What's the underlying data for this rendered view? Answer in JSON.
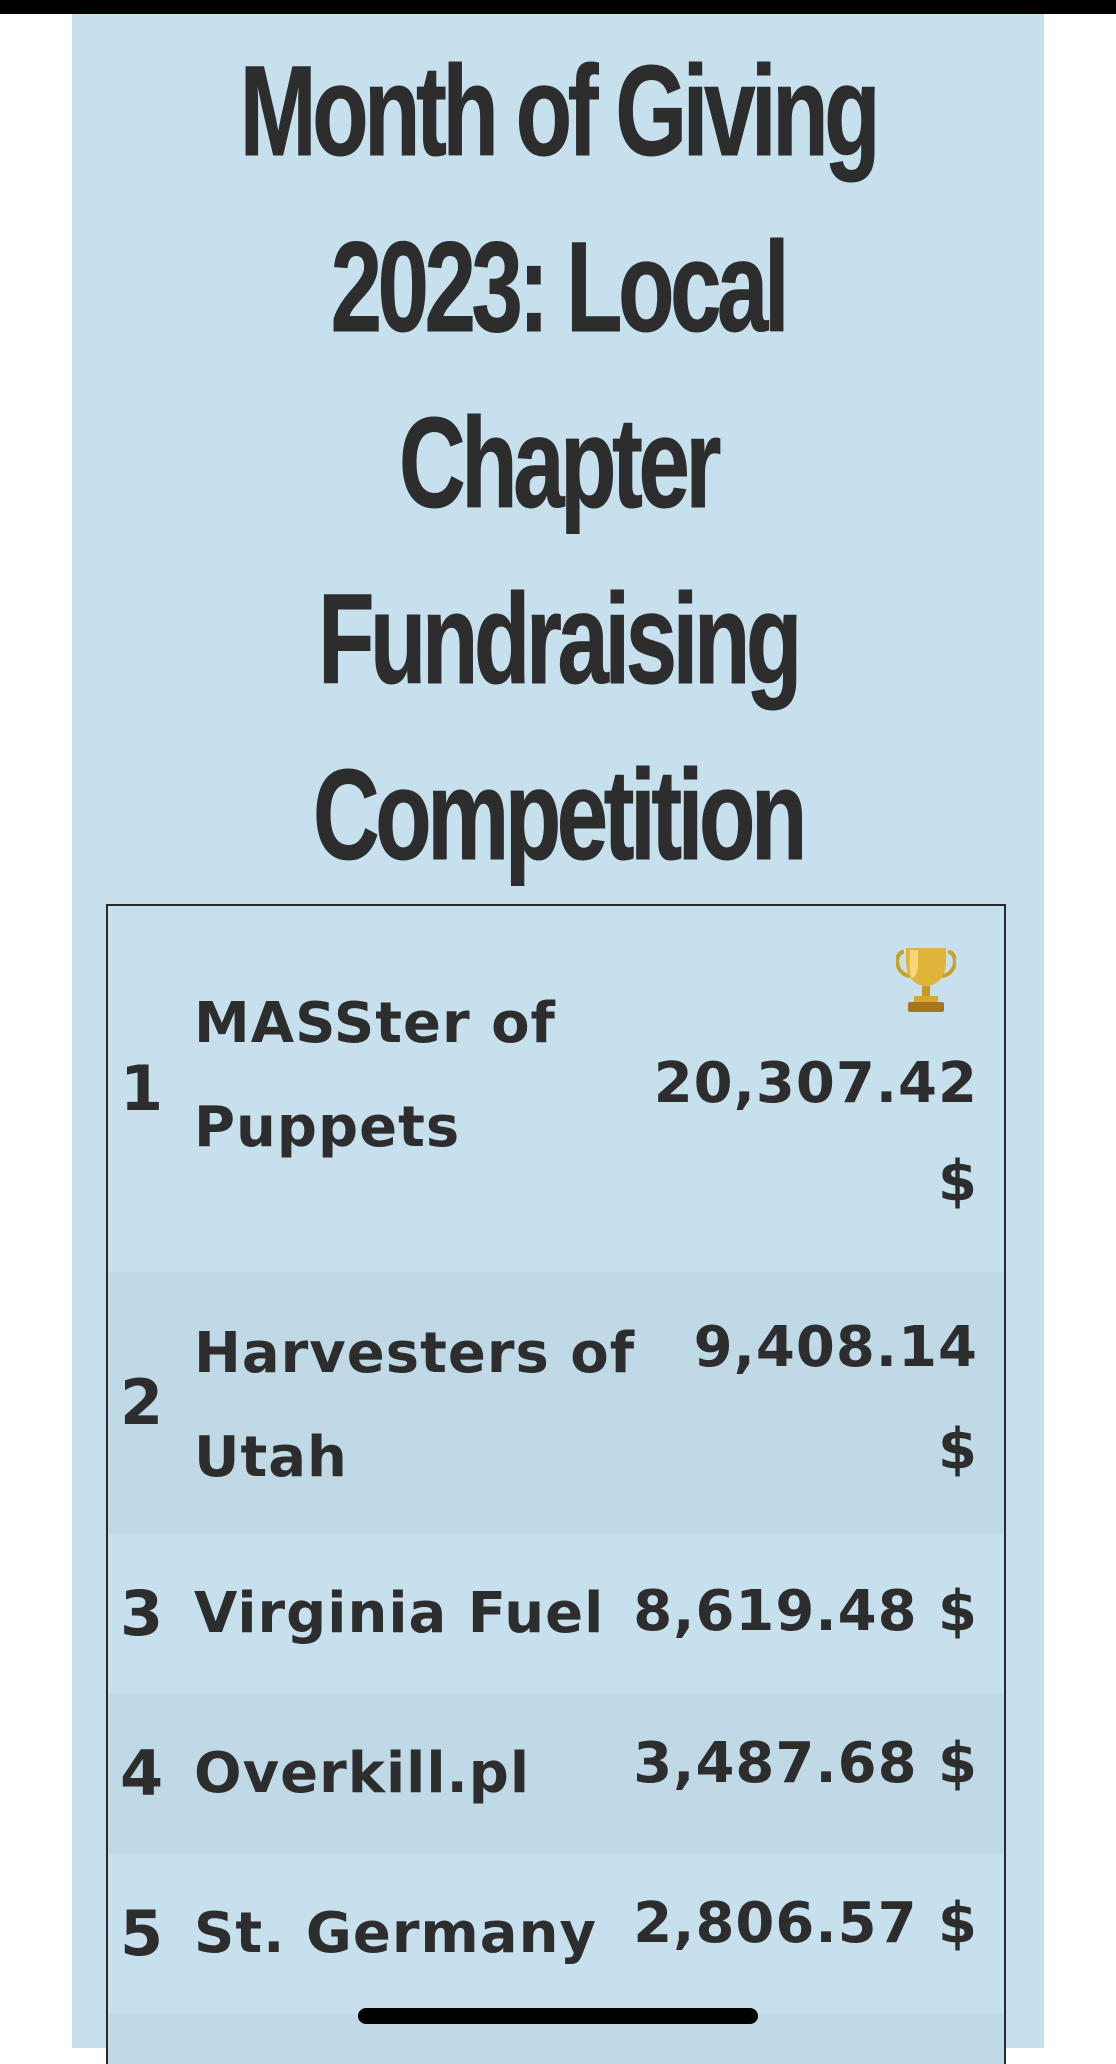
{
  "title": "Month of Giving 2023: Local Chapter Fundraising Competition",
  "colors": {
    "panel_background": "#c6e0ee",
    "row_alt_background": "#bfd9e6",
    "text": "#2d2d2d"
  },
  "leaderboard": [
    {
      "rank": "1",
      "name_line1": "MASSter of",
      "name_line2": "Puppets",
      "amount_line1": "20,307.42",
      "amount_line2": "$",
      "icon": "trophy-icon"
    },
    {
      "rank": "2",
      "name_line1": "Harvesters of",
      "name_line2": "Utah",
      "amount_line1": "9,408.14",
      "amount_line2": "$"
    },
    {
      "rank": "3",
      "name": "Virginia Fuel",
      "amount": "8,619.48 $"
    },
    {
      "rank": "4",
      "name": "Overkill.pl",
      "amount": "3,487.68 $"
    },
    {
      "rank": "5",
      "name": "St. Germany",
      "amount": "2,806.57 $"
    }
  ]
}
